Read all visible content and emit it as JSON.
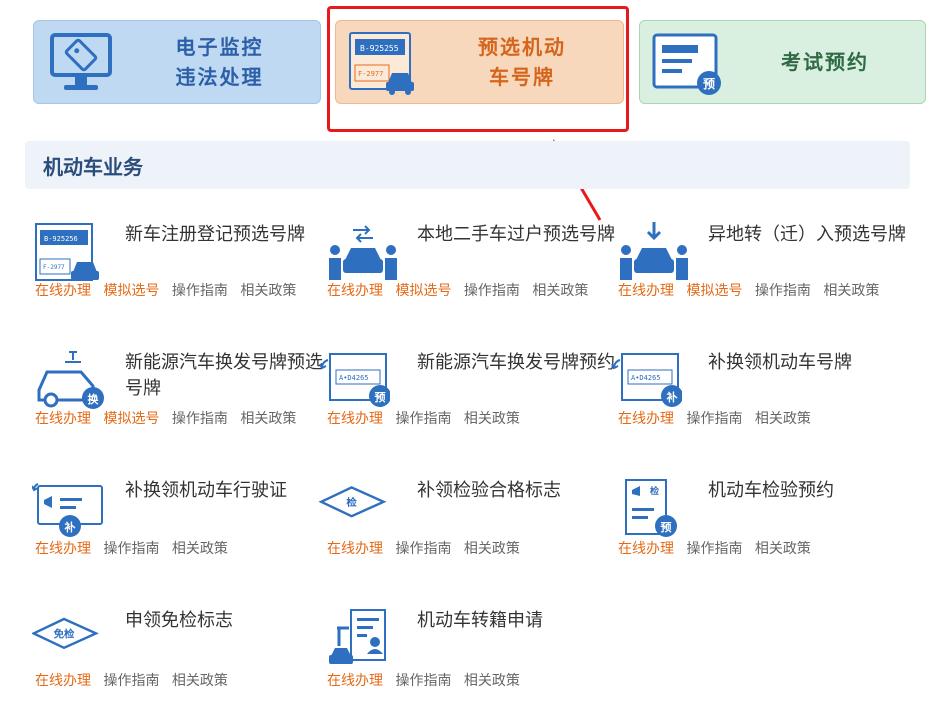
{
  "top_cards": [
    {
      "line1": "电子监控",
      "line2": "违法处理",
      "icon": "monitor-tag-icon"
    },
    {
      "line1": "预选机动",
      "line2": "车号牌",
      "plate1": "B-925255",
      "plate2": "F-2977",
      "icon": "license-plate-car-icon"
    },
    {
      "line1": "考试预约",
      "icon_badge": "预",
      "icon": "exam-card-icon"
    }
  ],
  "section_title": "机动车业务",
  "services": [
    {
      "title": "新车注册登记预选号牌",
      "icon": "plate-car-icon",
      "links": [
        "在线办理",
        "模拟选号",
        "操作指南",
        "相关政策"
      ],
      "plate1": "B-925256",
      "plate2": "F-2977"
    },
    {
      "title": "本地二手车过户预选号牌",
      "icon": "car-transfer-icon",
      "links": [
        "在线办理",
        "模拟选号",
        "操作指南",
        "相关政策"
      ]
    },
    {
      "title": "异地转（迁）入预选号牌",
      "icon": "car-transfer-in-icon",
      "links": [
        "在线办理",
        "模拟选号",
        "操作指南",
        "相关政策"
      ]
    },
    {
      "title": "新能源汽车换发号牌预选号牌",
      "icon": "ev-car-icon",
      "badge": "换",
      "links": [
        "在线办理",
        "模拟选号",
        "操作指南",
        "相关政策"
      ]
    },
    {
      "title": "新能源汽车换发号牌预约",
      "icon": "plate-reserve-icon",
      "badge": "预",
      "plate": "A•D4265",
      "links": [
        "在线办理",
        "操作指南",
        "相关政策"
      ]
    },
    {
      "title": "补换领机动车号牌",
      "icon": "plate-replace-icon",
      "badge": "补",
      "plate": "A•D4265",
      "links": [
        "在线办理",
        "操作指南",
        "相关政策"
      ]
    },
    {
      "title": "补换领机动车行驶证",
      "icon": "license-card-icon",
      "badge": "补",
      "links": [
        "在线办理",
        "操作指南",
        "相关政策"
      ]
    },
    {
      "title": "补领检验合格标志",
      "icon": "inspection-diamond-icon",
      "badge": "检",
      "links": [
        "在线办理",
        "操作指南",
        "相关政策"
      ]
    },
    {
      "title": "机动车检验预约",
      "icon": "inspection-doc-icon",
      "badge": "预",
      "tag": "检",
      "links": [
        "在线办理",
        "操作指南",
        "相关政策"
      ]
    },
    {
      "title": "申领免检标志",
      "icon": "exempt-diamond-icon",
      "badge": "免检",
      "links": [
        "在线办理",
        "操作指南",
        "相关政策"
      ]
    },
    {
      "title": "机动车转籍申请",
      "icon": "transfer-registry-icon",
      "links": [
        "在线办理",
        "操作指南",
        "相关政策"
      ]
    }
  ],
  "colors": {
    "accent_orange": "#e56a17",
    "icon_blue": "#2f6fc0",
    "highlight_red": "#e8191b",
    "section_text": "#2a4d7c"
  }
}
